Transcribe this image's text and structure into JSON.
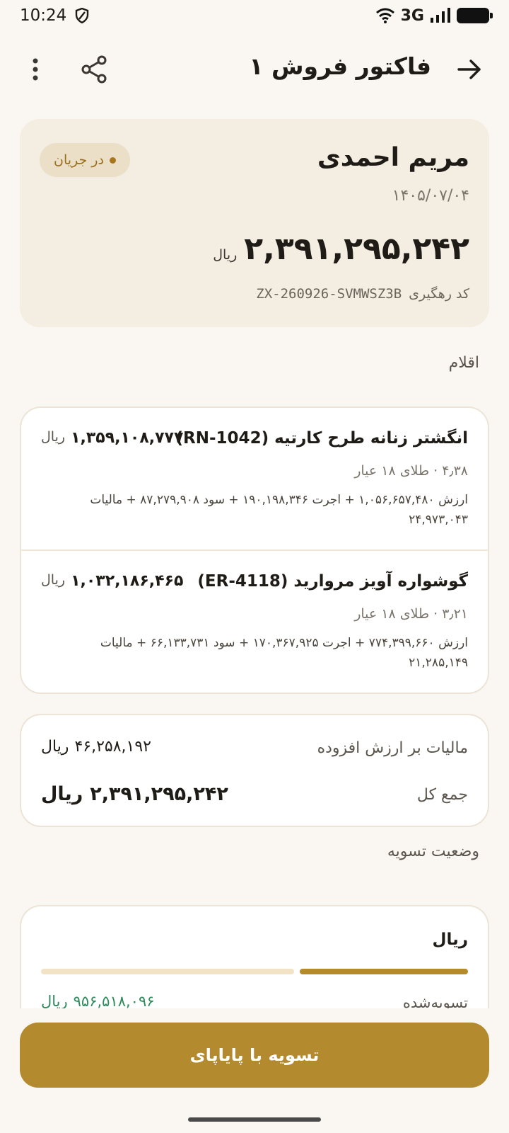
{
  "status_bar": {
    "time": "10:24",
    "network": "3G",
    "icons": [
      "shield-icon",
      "wifi-icon",
      "signal-icon",
      "battery-icon"
    ]
  },
  "app_bar": {
    "title": "فاکتور فروش ۱",
    "icons": [
      "arrow-right-icon",
      "share-icon",
      "more-vert-icon"
    ]
  },
  "summary": {
    "customer_name": "مریم احمدی",
    "status": "در جریان",
    "date": "۱۴۰۵/۰۷/۰۴",
    "amount": "۲,۳۹۱,۲۹۵,۲۴۲",
    "currency": "ریال",
    "tracking_label": "کد رهگیری",
    "tracking_code": "ZX-260926-SVMWSZ3B"
  },
  "items_section_title": "اقلام",
  "items": [
    {
      "name": "انگشتر زنانه طرح کارتیه (RN-1042)",
      "price": "۱,۳۵۹,۱۰۸,۷۷۷",
      "unit": "ریال",
      "meta": "۴٫۳۸ · طلای ۱۸ عیار",
      "breakdown": "ارزش ۱,۰۵۶,۶۵۷,۴۸۰ + اجرت ۱۹۰,۱۹۸,۳۴۶ + سود ۸۷,۲۷۹,۹۰۸ + مالیات ۲۴,۹۷۳,۰۴۳"
    },
    {
      "name": "گوشواره آویز مروارید (ER-4118)",
      "price": "۱,۰۳۲,۱۸۶,۴۶۵",
      "unit": "ریال",
      "meta": "۳٫۲۱ · طلای ۱۸ عیار",
      "breakdown": "ارزش ۷۷۴,۳۹۹,۶۶۰ + اجرت ۱۷۰,۳۶۷,۹۲۵ + سود ۶۶,۱۳۳,۷۳۱ + مالیات ۲۱,۲۸۵,۱۴۹"
    }
  ],
  "totals": {
    "vat_label": "مالیات بر ارزش افزوده",
    "vat_value": "۴۶,۲۵۸,۱۹۲",
    "total_label": "جمع کل",
    "total_value": "۲,۳۹۱,۲۹۵,۲۴۲",
    "currency": "ریال"
  },
  "settlement": {
    "section_title": "وضعیت تسویه",
    "currency_label": "ریال",
    "progress": 0.4,
    "settled_label": "تسویه‌شده",
    "settled_value": "۹۵۶,۵۱۸,۰۹۶",
    "currency": "ریال",
    "colors": {
      "fill": "#b58a2a",
      "rest": "#f2e3c6",
      "settled_text": "#2e8a5b"
    }
  },
  "action_button": "تسویه با پایاپای",
  "colors": {
    "accent": "#b48a2e",
    "background": "#faf7f2",
    "card": "#f3ede2"
  }
}
